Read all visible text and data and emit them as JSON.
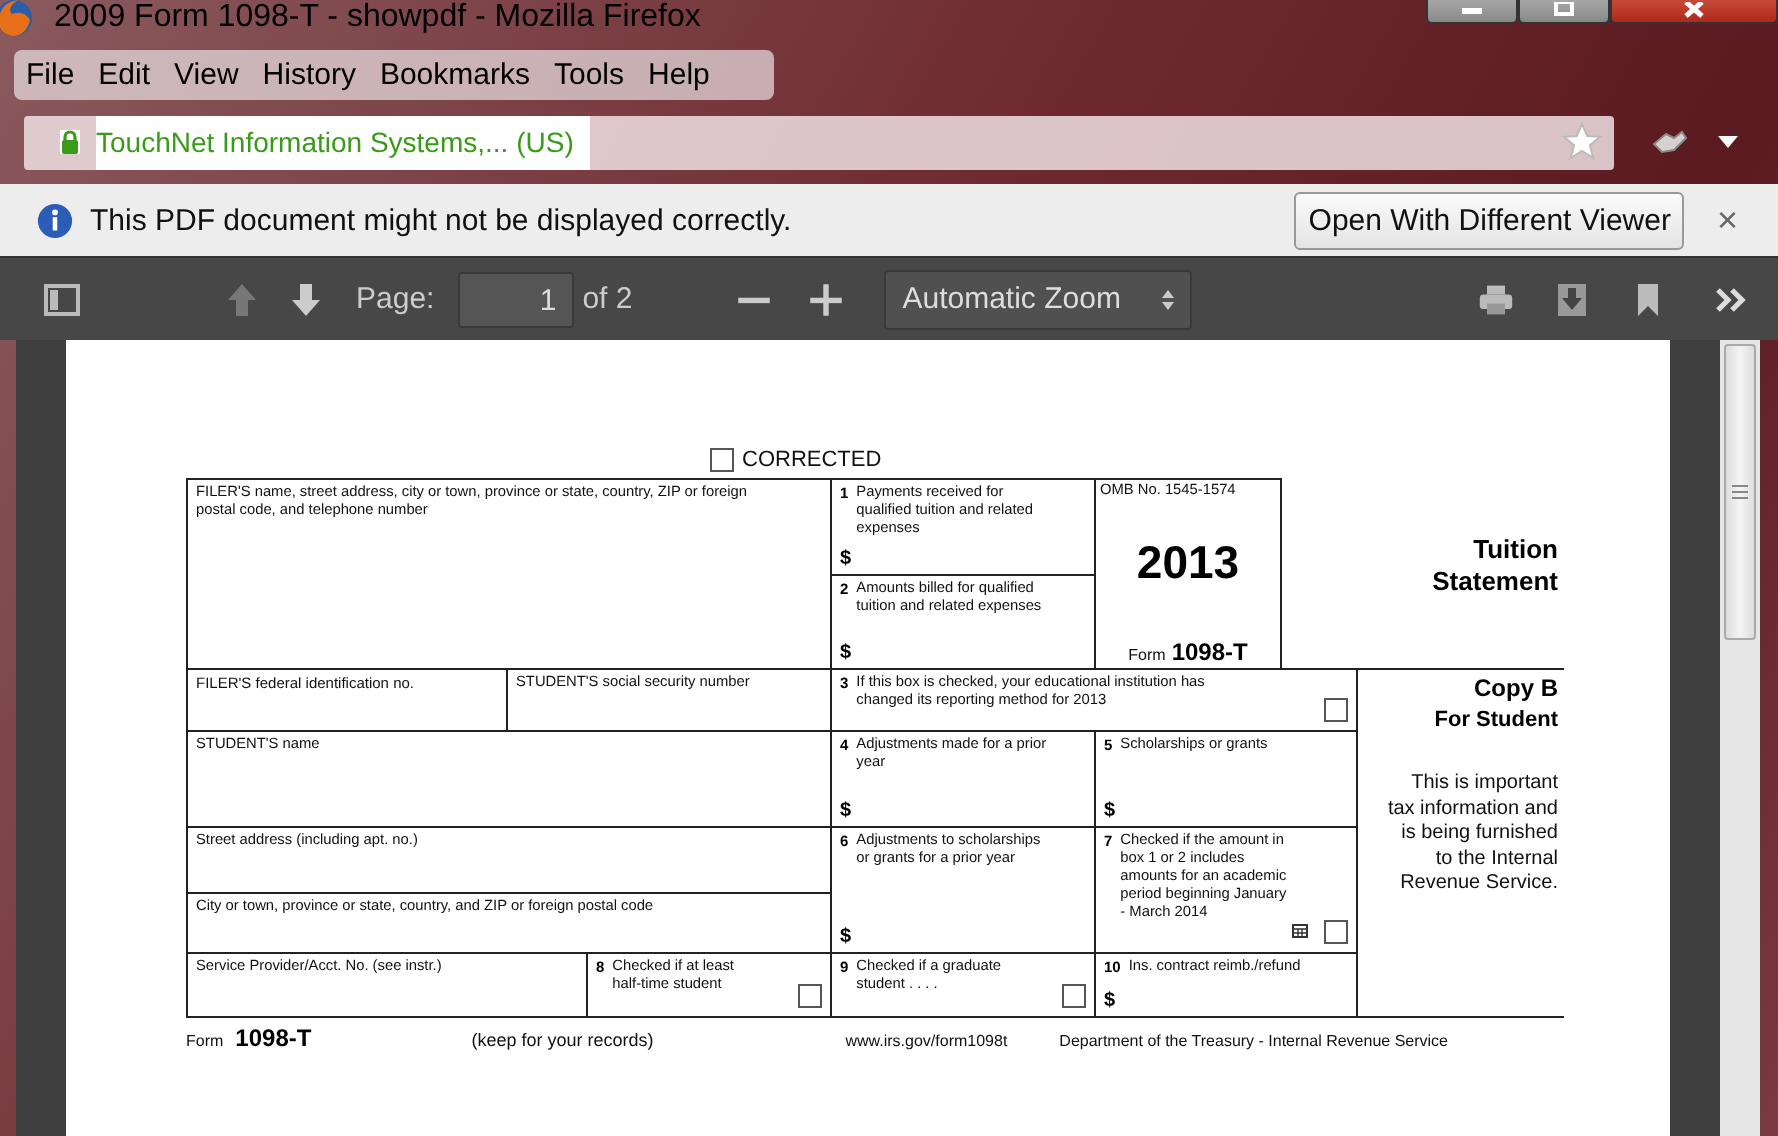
{
  "window": {
    "title": "2009 Form 1098-T - showpdf - Mozilla Firefox"
  },
  "menu": [
    {
      "label": "File"
    },
    {
      "label": "Edit"
    },
    {
      "label": "View"
    },
    {
      "label": "History"
    },
    {
      "label": "Bookmarks"
    },
    {
      "label": "Tools"
    },
    {
      "label": "Help"
    }
  ],
  "address_bar": {
    "identity": "TouchNet Information Systems,...  (US)"
  },
  "notification": {
    "message": "This PDF document might not be displayed correctly.",
    "button": "Open With Different Viewer",
    "close": "×"
  },
  "pdf_toolbar": {
    "page_label": "Page:",
    "page_value": "1",
    "page_count": "of 2",
    "zoom": "Automatic Zoom"
  },
  "form": {
    "corrected": {
      "label": "CORRECTED",
      "checked": false
    },
    "filer": "FILER'S name, street address, city or town, province or state, country, ZIP or foreign postal code, and telephone number",
    "omb": "OMB No. 1545-1574",
    "year": "2013",
    "form_label": "Form",
    "form_number": "1098-T",
    "title": "Tuition Statement",
    "filer_id": "FILER'S federal identification no.",
    "student_ssn": "STUDENT'S social security number",
    "student_name": "STUDENT'S name",
    "street": "Street address (including apt. no.)",
    "city": "City or town, province or state, country, and ZIP or foreign postal code",
    "service": "Service Provider/Acct. No. (see instr.)",
    "copy": "Copy B",
    "copy_for": "For Student",
    "notice": "This is important tax information and is being furnished to the Internal Revenue Service.",
    "boxes": [
      {
        "number": "1",
        "label": "Payments received for qualified tuition and related expenses",
        "kind": "amount",
        "currency": "$"
      },
      {
        "number": "2",
        "label": "Amounts billed for qualified tuition and related expenses",
        "kind": "amount",
        "currency": "$"
      },
      {
        "number": "3",
        "label": "If this box is checked, your educational institution has changed its reporting method for 2013",
        "kind": "check",
        "checked": false
      },
      {
        "number": "4",
        "label": "Adjustments made for a prior year",
        "kind": "amount",
        "currency": "$"
      },
      {
        "number": "5",
        "label": "Scholarships or grants",
        "kind": "amount",
        "currency": "$"
      },
      {
        "number": "6",
        "label": "Adjustments to scholarships or grants for a prior year",
        "kind": "amount",
        "currency": "$"
      },
      {
        "number": "7",
        "label": "Checked if the amount in box 1 or 2 includes amounts for an academic period beginning January - March 2014",
        "kind": "check",
        "checked": false
      },
      {
        "number": "8",
        "label": "Checked if at least half-time student",
        "kind": "check",
        "checked": false
      },
      {
        "number": "9",
        "label": "Checked if a graduate student . . . .",
        "kind": "check",
        "checked": false
      },
      {
        "number": "10",
        "label": "Ins. contract reimb./refund",
        "kind": "amount",
        "currency": "$"
      }
    ],
    "footer": {
      "form_label": "Form",
      "form_number": "1098-T",
      "keep": "(keep for your records)",
      "url": "www.irs.gov/form1098t",
      "department": "Department of the Treasury - Internal Revenue Service"
    }
  }
}
